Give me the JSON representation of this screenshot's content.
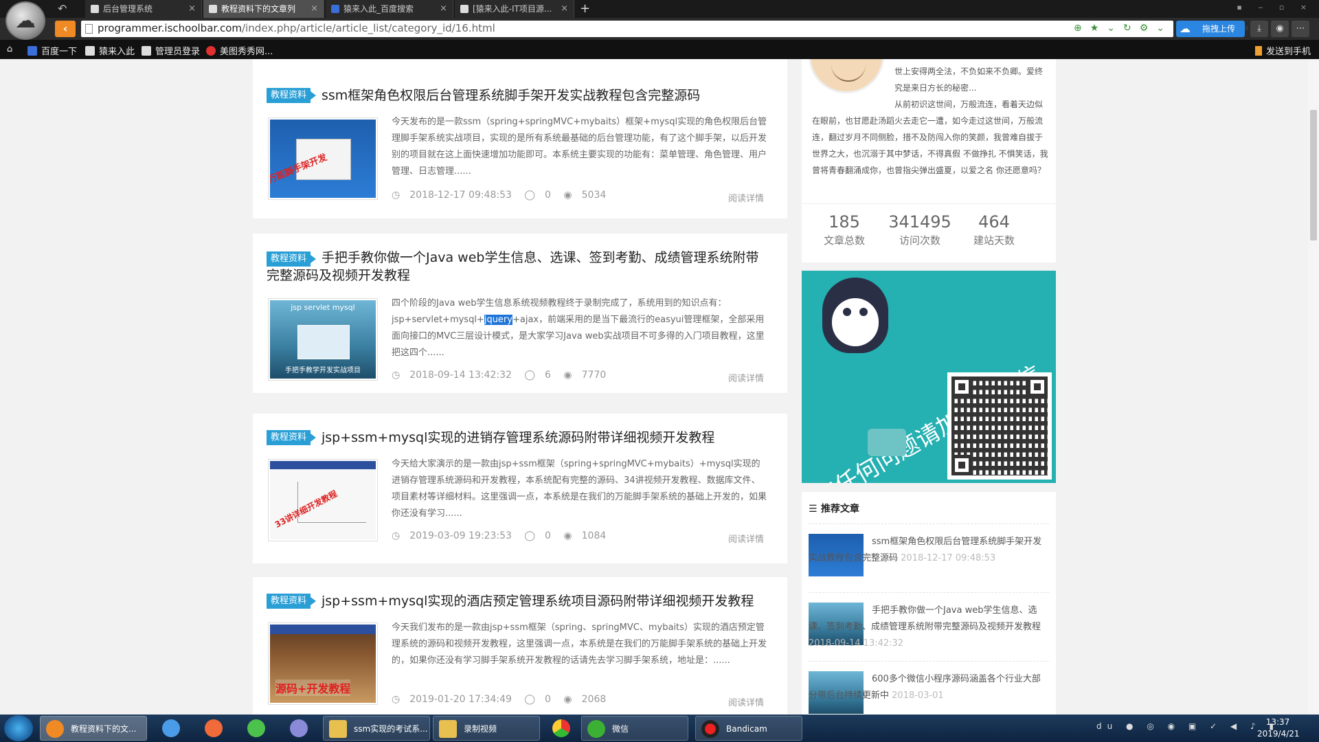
{
  "browser": {
    "tabs": [
      {
        "label": "后台管理系统",
        "close": "×"
      },
      {
        "label": "教程资料下的文章列",
        "close": "×"
      },
      {
        "label": "猿来入此_百度搜索",
        "close": "×"
      },
      {
        "label": "[猿来入此-IT项目源...",
        "close": "×"
      }
    ],
    "new_tab": "+",
    "url_host": "programmer.ischoolbar.com",
    "url_path": "/index.php/article/article_list/category_id/16.html",
    "upload_label": "拖拽上传",
    "bookmarks": [
      "百度一下",
      "猿来入此",
      "管理员登录",
      "美图秀秀网..."
    ],
    "send_to_phone": "发送到手机"
  },
  "articles": [
    {
      "badge": "教程资料",
      "title": "ssm框架角色权限后台管理系统脚手架开发实战教程包含完整源码",
      "excerpt": "今天发布的是一款ssm（spring+springMVC+mybaits）框架+mysql实现的角色权限后台管理脚手架系统实战项目，实现的是所有系统最基础的后台管理功能，有了这个脚手架，以后开发别的项目就在这上面快速增加功能即可。本系统主要实现的功能有：菜单管理、角色管理、用户管理、日志管理......",
      "date": "2018-12-17 09:48:53",
      "comments": "0",
      "views": "5034",
      "readmore": "阅读详情"
    },
    {
      "badge": "教程资料",
      "title": "手把手教你做一个Java web学生信息、选课、签到考勤、成绩管理系统附带完整源码及视频开发教程",
      "excerpt_a": "四个阶段的Java web学生信息系统视频教程终于录制完成了，系统用到的知识点有：jsp+servlet+mysql+",
      "excerpt_sel": "jquery",
      "excerpt_b": "+ajax，前端采用的是当下最流行的easyui管理框架，全部采用面向接口的MVC三层设计模式，是大家学习Java web实战项目不可多得的入门项目教程，这里把这四个......",
      "date": "2018-09-14 13:42:32",
      "comments": "6",
      "views": "7770",
      "readmore": "阅读详情"
    },
    {
      "badge": "教程资料",
      "title": "jsp+ssm+mysql实现的进销存管理系统源码附带详细视频开发教程",
      "excerpt": "今天给大家演示的是一款由jsp+ssm框架（spring+springMVC+mybaits）+mysql实现的进销存管理系统源码和开发教程，本系统配有完整的源码、34讲视频开发教程、数据库文件、项目素材等详细材料。这里强调一点，本系统是在我们的万能脚手架系统的基础上开发的，如果你还没有学习......",
      "date": "2019-03-09 19:23:53",
      "comments": "0",
      "views": "1084",
      "readmore": "阅读详情"
    },
    {
      "badge": "教程资料",
      "title": "jsp+ssm+mysql实现的酒店预定管理系统项目源码附带详细视频开发教程",
      "excerpt": "今天我们发布的是一款由jsp+ssm框架（spring、springMVC、mybaits）实现的酒店预定管理系统的源码和视频开发教程，这里强调一点，本系统是在我们的万能脚手架系统的基础上开发的，如果你还没有学习脚手架系统开发教程的话请先去学习脚手架系统，地址是：......",
      "date": "2019-01-20 17:34:49",
      "comments": "0",
      "views": "2068",
      "readmore": "阅读详情"
    }
  ],
  "thumbs": {
    "t1_stamp": "万能脚手架开发",
    "t2_header": "jsp servlet mysql",
    "t2_footer": "手把手教学开发实战项目",
    "t3_stamp": "33讲详细开发教程",
    "t4_stamp": "源码+开发教程"
  },
  "profile": {
    "bio_a": "世上安得两全法，不负如来不负卿。爱终究是来日方长的秘密...",
    "bio_b": "从前初识这世间，万般流连，看着天边似在眼前，也甘愿赴汤蹈火去走它一遭，如今走过这世间，万般流连，翻过岁月不同侧脸，措不及防闯入你的笑颜，我曾难自拔于世界之大，也沉溺于其中梦话，不得真假 不做挣扎 不惧笑话，我曾将青春翻涌成你，也曾指尖弹出盛夏，以爱之名 你还愿意吗？",
    "stats": [
      {
        "num": "185",
        "label": "文章总数"
      },
      {
        "num": "341495",
        "label": "访问次数"
      },
      {
        "num": "464",
        "label": "建站天数"
      }
    ]
  },
  "banner": {
    "text": "有任何问题请加站长微信"
  },
  "recommend": {
    "title": "推荐文章",
    "items": [
      {
        "title": "ssm框架角色权限后台管理系统脚手架开发实战教程包含完整源码",
        "date": "2018-12-17 09:48:53"
      },
      {
        "title": "手把手教你做一个Java web学生信息、选课、签到考勤、成绩管理系统附带完整源码及视频开发教程",
        "date": "2018-09-14 13:42:32"
      },
      {
        "title": "600多个微信小程序源码涵盖各个行业大部分带后台持续更新中",
        "date": "2018-03-01"
      }
    ]
  },
  "taskbar": {
    "items": [
      "教程资料下的文...",
      "ssm实现的考试系...",
      "录制视频",
      "微信",
      "Bandicam"
    ],
    "time": "13:37",
    "date": "2019/4/21"
  },
  "colors": {
    "accent": "#2a9fd6",
    "banner": "#25b0b2",
    "selection": "#1e74d8"
  }
}
